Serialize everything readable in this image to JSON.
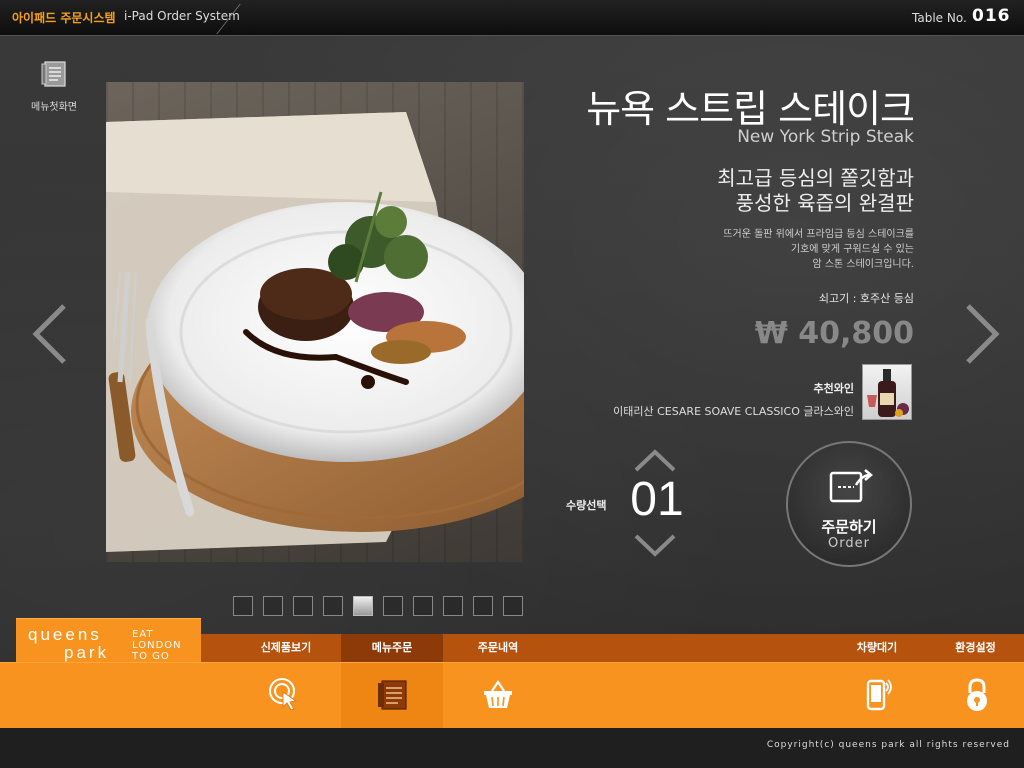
{
  "header": {
    "brand": "아이패드 주문시스템",
    "subtitle": "i-Pad Order System",
    "table_label": "Table No.",
    "table_number": "016"
  },
  "menu_home": {
    "label": "메뉴첫화면",
    "icon": "menu-book-icon"
  },
  "product": {
    "name_ko": "뉴욕 스트립 스테이크",
    "name_en": "New York Strip Steak",
    "tagline_line1": "최고급 등심의 쫄깃함과",
    "tagline_line2": "풍성한 육즙의 완결판",
    "desc_line1": "뜨거운 돌판 위에서 프라임급 등심 스테이크를",
    "desc_line2": "기호에 맞게 구워드실 수 있는",
    "desc_line3": "암 스톤 스테이크입니다.",
    "origin": "쇠고기 : 호주산 등심",
    "price": "₩ 40,800"
  },
  "wine": {
    "label": "추천와인",
    "name": "이태리산 CESARE SOAVE CLASSICO 글라스와인"
  },
  "quantity": {
    "label": "수량선택",
    "value": "01"
  },
  "order_button": {
    "label_ko": "주문하기",
    "label_en": "Order"
  },
  "pagination": {
    "count": 10,
    "active_index": 4
  },
  "logo": {
    "line1": "queens",
    "line2": "park",
    "tag1": "EAT",
    "tag2": "LONDON",
    "tag3": "TO GO"
  },
  "tabs": [
    {
      "label": "신제품보기"
    },
    {
      "label": "메뉴주문"
    },
    {
      "label": "주문내역"
    },
    {
      "label": "차량대기"
    },
    {
      "label": "환경설정"
    }
  ],
  "icons": [
    "touch-icon",
    "menu-book-icon",
    "basket-icon",
    "phone-icon",
    "lock-icon"
  ],
  "colors": {
    "accent": "#f7931e",
    "accent_dark": "#b5520e",
    "brand_text": "#f7a21b"
  },
  "footer": {
    "copyright": "Copyright(c) queens park all rights reserved"
  }
}
